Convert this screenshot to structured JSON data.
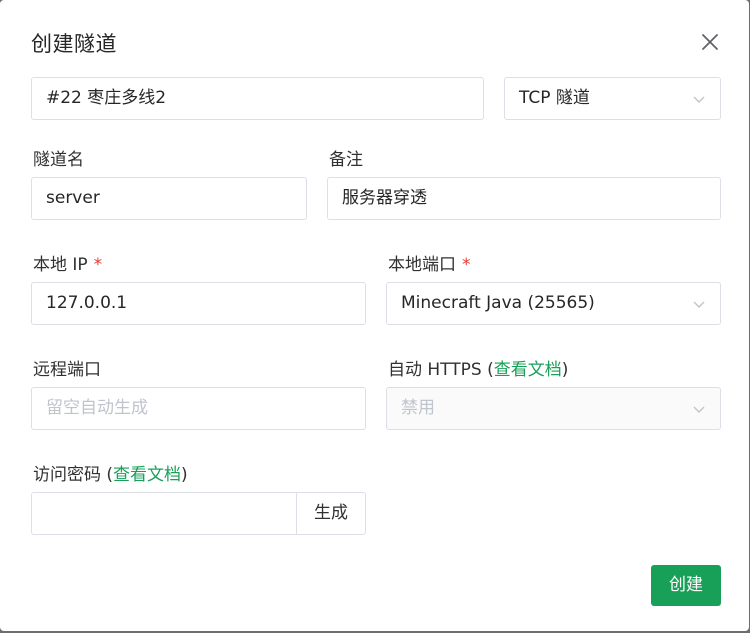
{
  "dialog": {
    "title": "创建隧道"
  },
  "node_select": {
    "value": "#22 枣庄多线2"
  },
  "type_select": {
    "value": "TCP 隧道"
  },
  "name_field": {
    "label": "隧道名",
    "value": "server"
  },
  "remark_field": {
    "label": "备注",
    "value": "服务器穿透"
  },
  "local_ip_field": {
    "label": "本地 IP",
    "required_mark": "*",
    "value": "127.0.0.1"
  },
  "local_port_field": {
    "label": "本地端口",
    "required_mark": "*",
    "value": "Minecraft Java (25565)"
  },
  "remote_port_field": {
    "label": "远程端口",
    "placeholder": "留空自动生成"
  },
  "auto_https_field": {
    "label_prefix": "自动 HTTPS (",
    "link_text": "查看文档",
    "label_suffix": ")",
    "value": "禁用"
  },
  "access_password_field": {
    "label_prefix": "访问密码 (",
    "link_text": "查看文档",
    "label_suffix": ")",
    "value": "",
    "generate_label": "生成"
  },
  "footer": {
    "create_label": "创建"
  },
  "colors": {
    "primary": "#18a058",
    "required": "#e53935",
    "border": "#dcdfe6"
  },
  "icons": {
    "close": "close-icon",
    "dropdown": "chevron-down-icon"
  }
}
